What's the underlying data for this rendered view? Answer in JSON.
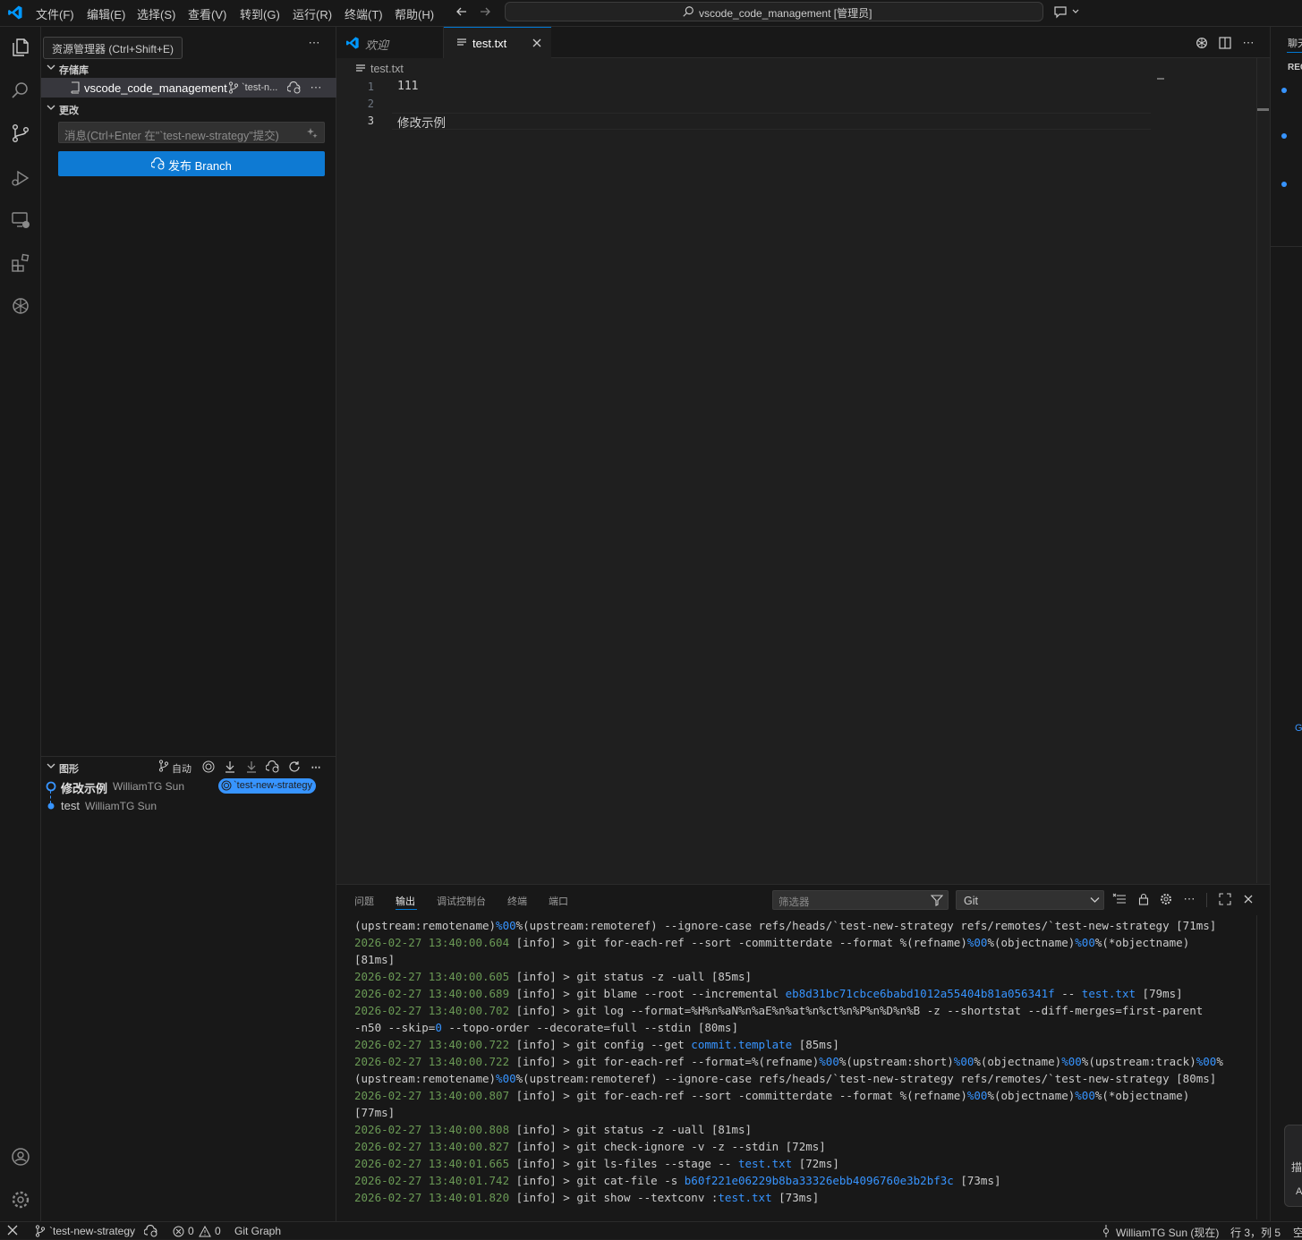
{
  "titlebar": {
    "menus": [
      "文件(F)",
      "编辑(E)",
      "选择(S)",
      "查看(V)",
      "转到(G)",
      "运行(R)",
      "终端(T)",
      "帮助(H)"
    ],
    "search_text": "vscode_code_management [管理员]"
  },
  "tooltip": "资源管理器 (Ctrl+Shift+E)",
  "sidebar": {
    "repos_title": "存储库",
    "repo_name": "vscode_code_management",
    "repo_branch": "`test-n...",
    "changes_title": "更改",
    "commit_placeholder": "消息(Ctrl+Enter 在\"`test-new-strategy\"提交)",
    "publish_label": "发布 Branch",
    "graph_title": "图形",
    "graph_auto": "自动",
    "commits": [
      {
        "message": "修改示例",
        "author": "WilliamTG Sun",
        "badge": "`test-new-strategy"
      },
      {
        "message": "test",
        "author": "WilliamTG Sun"
      }
    ]
  },
  "tabs": [
    {
      "label": "欢迎",
      "active": false
    },
    {
      "label": "test.txt",
      "active": true
    }
  ],
  "editor": {
    "breadcrumb": "test.txt",
    "lines": [
      {
        "no": "1",
        "text": "111"
      },
      {
        "no": "2",
        "text": ""
      },
      {
        "no": "3",
        "text": "修改示例"
      }
    ]
  },
  "panel": {
    "tabs": [
      "问题",
      "输出",
      "调试控制台",
      "终端",
      "端口"
    ],
    "active_tab": "输出",
    "filter_placeholder": "筛选器",
    "channel": "Git",
    "log": [
      {
        "ts": "",
        "lvl": "",
        "text": "(upstream:remotename)%00%(upstream:remoteref) --ignore-case refs/heads/`test-new-strategy refs/remotes/`test-new-strategy [71ms]"
      },
      {
        "ts": "2026-02-27 13:40:00.604",
        "lvl": "[info]",
        "text": " > git for-each-ref --sort -committerdate --format %(refname)%00%(objectname)%00%(*objectname)"
      },
      {
        "ts": "",
        "lvl": "",
        "text": "[81ms]"
      },
      {
        "ts": "2026-02-27 13:40:00.605",
        "lvl": "[info]",
        "text": " > git status -z -uall [85ms]"
      },
      {
        "ts": "2026-02-27 13:40:00.689",
        "lvl": "[info]",
        "text": " > git blame --root --incremental eb8d31bc71cbce6babd1012a55404b81a056341f -- test.txt [79ms]"
      },
      {
        "ts": "2026-02-27 13:40:00.702",
        "lvl": "[info]",
        "text": " > git log --format=%H%n%aN%n%aE%n%at%n%ct%n%P%n%D%n%B -z --shortstat --diff-merges=first-parent"
      },
      {
        "ts": "",
        "lvl": "",
        "text": "-n50 --skip=0 --topo-order --decorate=full --stdin [80ms]"
      },
      {
        "ts": "2026-02-27 13:40:00.722",
        "lvl": "[info]",
        "text": " > git config --get commit.template [85ms]"
      },
      {
        "ts": "2026-02-27 13:40:00.722",
        "lvl": "[info]",
        "text": " > git for-each-ref --format=%(refname)%00%(upstream:short)%00%(objectname)%00%(upstream:track)%00%"
      },
      {
        "ts": "",
        "lvl": "",
        "text": "(upstream:remotename)%00%(upstream:remoteref) --ignore-case refs/heads/`test-new-strategy refs/remotes/`test-new-strategy [80ms]"
      },
      {
        "ts": "2026-02-27 13:40:00.807",
        "lvl": "[info]",
        "text": " > git for-each-ref --sort -committerdate --format %(refname)%00%(objectname)%00%(*objectname)"
      },
      {
        "ts": "",
        "lvl": "",
        "text": "[77ms]"
      },
      {
        "ts": "2026-02-27 13:40:00.808",
        "lvl": "[info]",
        "text": " > git status -z -uall [81ms]"
      },
      {
        "ts": "2026-02-27 13:40:00.827",
        "lvl": "[info]",
        "text": " > git check-ignore -v -z --stdin [72ms]"
      },
      {
        "ts": "2026-02-27 13:40:01.665",
        "lvl": "[info]",
        "text": " > git ls-files --stage -- test.txt [72ms]"
      },
      {
        "ts": "2026-02-27 13:40:01.742",
        "lvl": "[info]",
        "text": " > git cat-file -s b60f221e06229b8ba33326ebb4096760e3b2bf3c [73ms]"
      },
      {
        "ts": "2026-02-27 13:40:01.820",
        "lvl": "[info]",
        "text": " > git show --textconv :test.txt [73ms]"
      }
    ]
  },
  "aux": {
    "title": "聊天",
    "section": "REC",
    "letter_g": "G",
    "bottom_a": "描",
    "bottom_b": "A"
  },
  "statusbar": {
    "branch": "`test-new-strategy",
    "errors": "0",
    "warnings": "0",
    "git_graph": "Git Graph",
    "blame": "WilliamTG Sun (现在)",
    "position": "行 3，列 5",
    "extra": "空"
  },
  "colors": {
    "accent": "#0078d4",
    "publish_button": "#0e7ad3",
    "timestamp": "#6a9955",
    "link": "#3794ff"
  }
}
